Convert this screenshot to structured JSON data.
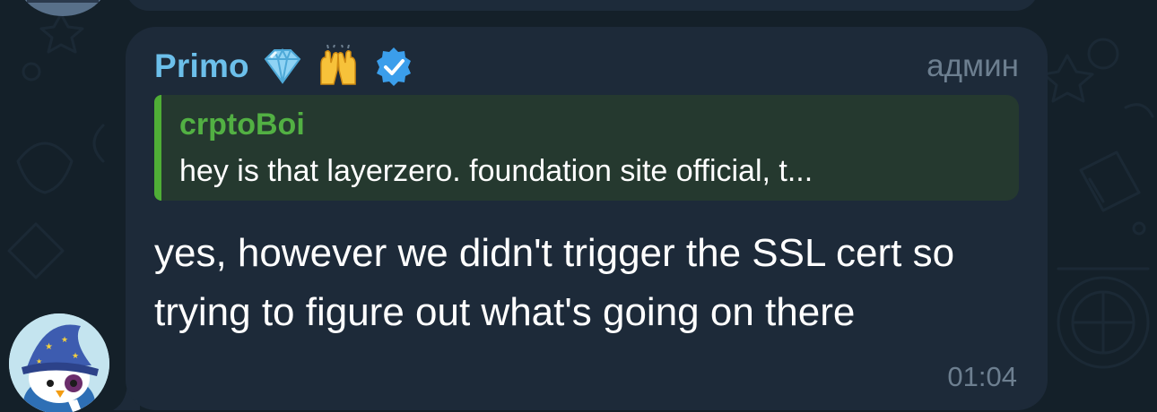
{
  "previous_message": {
    "avatar_icon": "user-avatar-icon"
  },
  "message": {
    "sender": {
      "name": "Primo",
      "name_color": "#6cbfea",
      "badges": [
        "gem-stone-icon",
        "raising-hands-icon",
        "verified-badge-icon"
      ]
    },
    "role": "админ",
    "reply": {
      "author": "crptoBoi",
      "author_color": "#52b043",
      "text": "hey is that layerzero. foundation site official, t..."
    },
    "text": "yes, however we didn't trigger the SSL cert so trying to figure out what's going on there",
    "time": "01:04",
    "avatar_icon": "wizard-penguin-avatar-icon"
  },
  "colors": {
    "chat_background": "#142029",
    "bubble": "#1d2a39",
    "reply_background": "#25392f",
    "reply_bar": "#4fae36",
    "meta_text": "#6d7f90"
  }
}
